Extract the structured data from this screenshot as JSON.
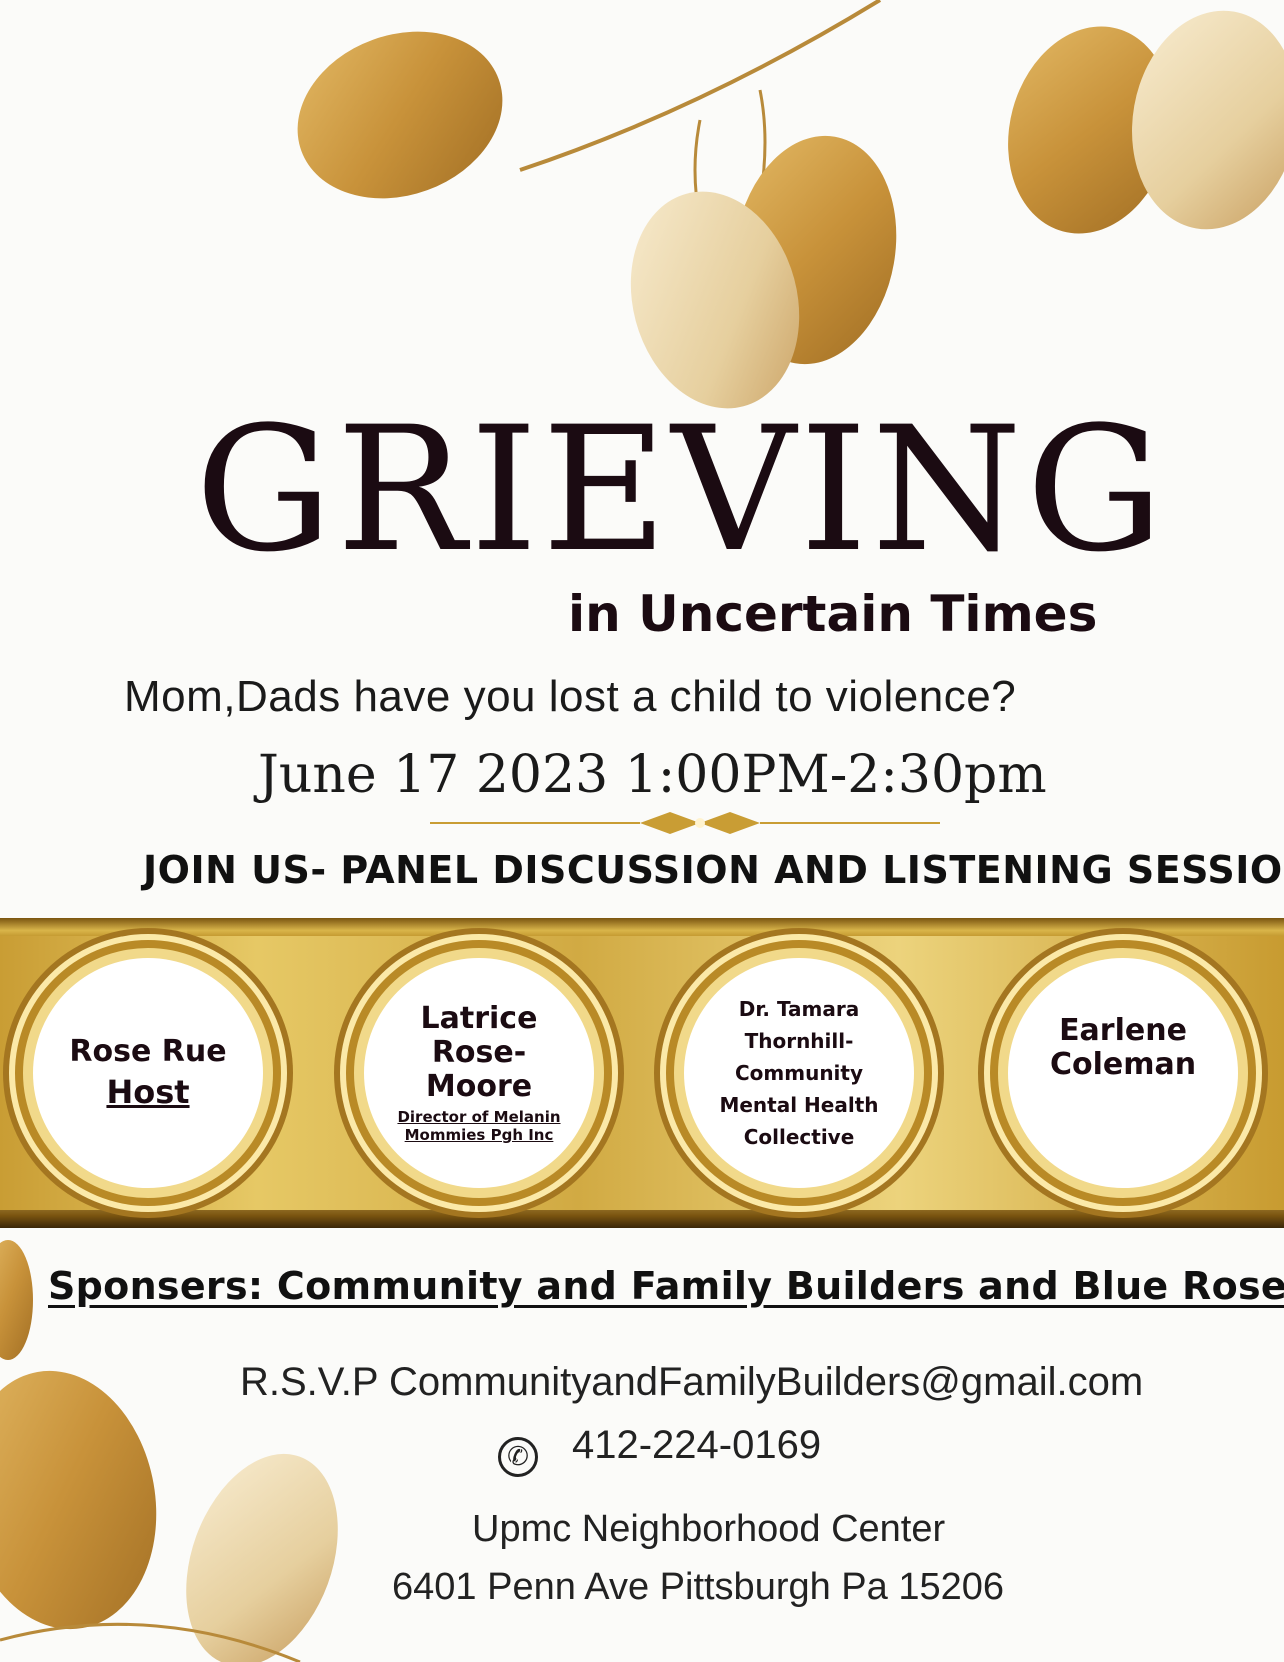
{
  "title": "GRIEVING",
  "subtitle": "in Uncertain  Times",
  "question": "Mom,Dads have you lost a child to violence?",
  "date": "June 17 2023 1:00PM-2:30pm",
  "join": "JOIN US- PANEL DISCUSSION AND LISTENING SESSION",
  "speakers": [
    {
      "name": "Rose Rue",
      "role": "Host"
    },
    {
      "name": "Latrice Rose-Moore",
      "role": "Director of Melanin Mommies Pgh Inc"
    },
    {
      "name": "Dr. Tamara Thornhill-",
      "role": "Community Mental Health Collective"
    },
    {
      "name": "Earlene Coleman",
      "role": ""
    }
  ],
  "sponsors": "Sponsers: Community and Family Builders and Blue Rose",
  "rsvp": "R.S.V.P CommunityandFamilyBuilders@gmail.com",
  "phone": "412-224-0169",
  "venue": "Upmc Neighborhood Center",
  "address": "6401 Penn Ave Pittsburgh Pa 15206",
  "icons": {
    "phone": "phone-icon",
    "divider": "ornament-divider-icon"
  },
  "colors": {
    "gold": "#c99d34",
    "dark": "#1b0b12"
  }
}
